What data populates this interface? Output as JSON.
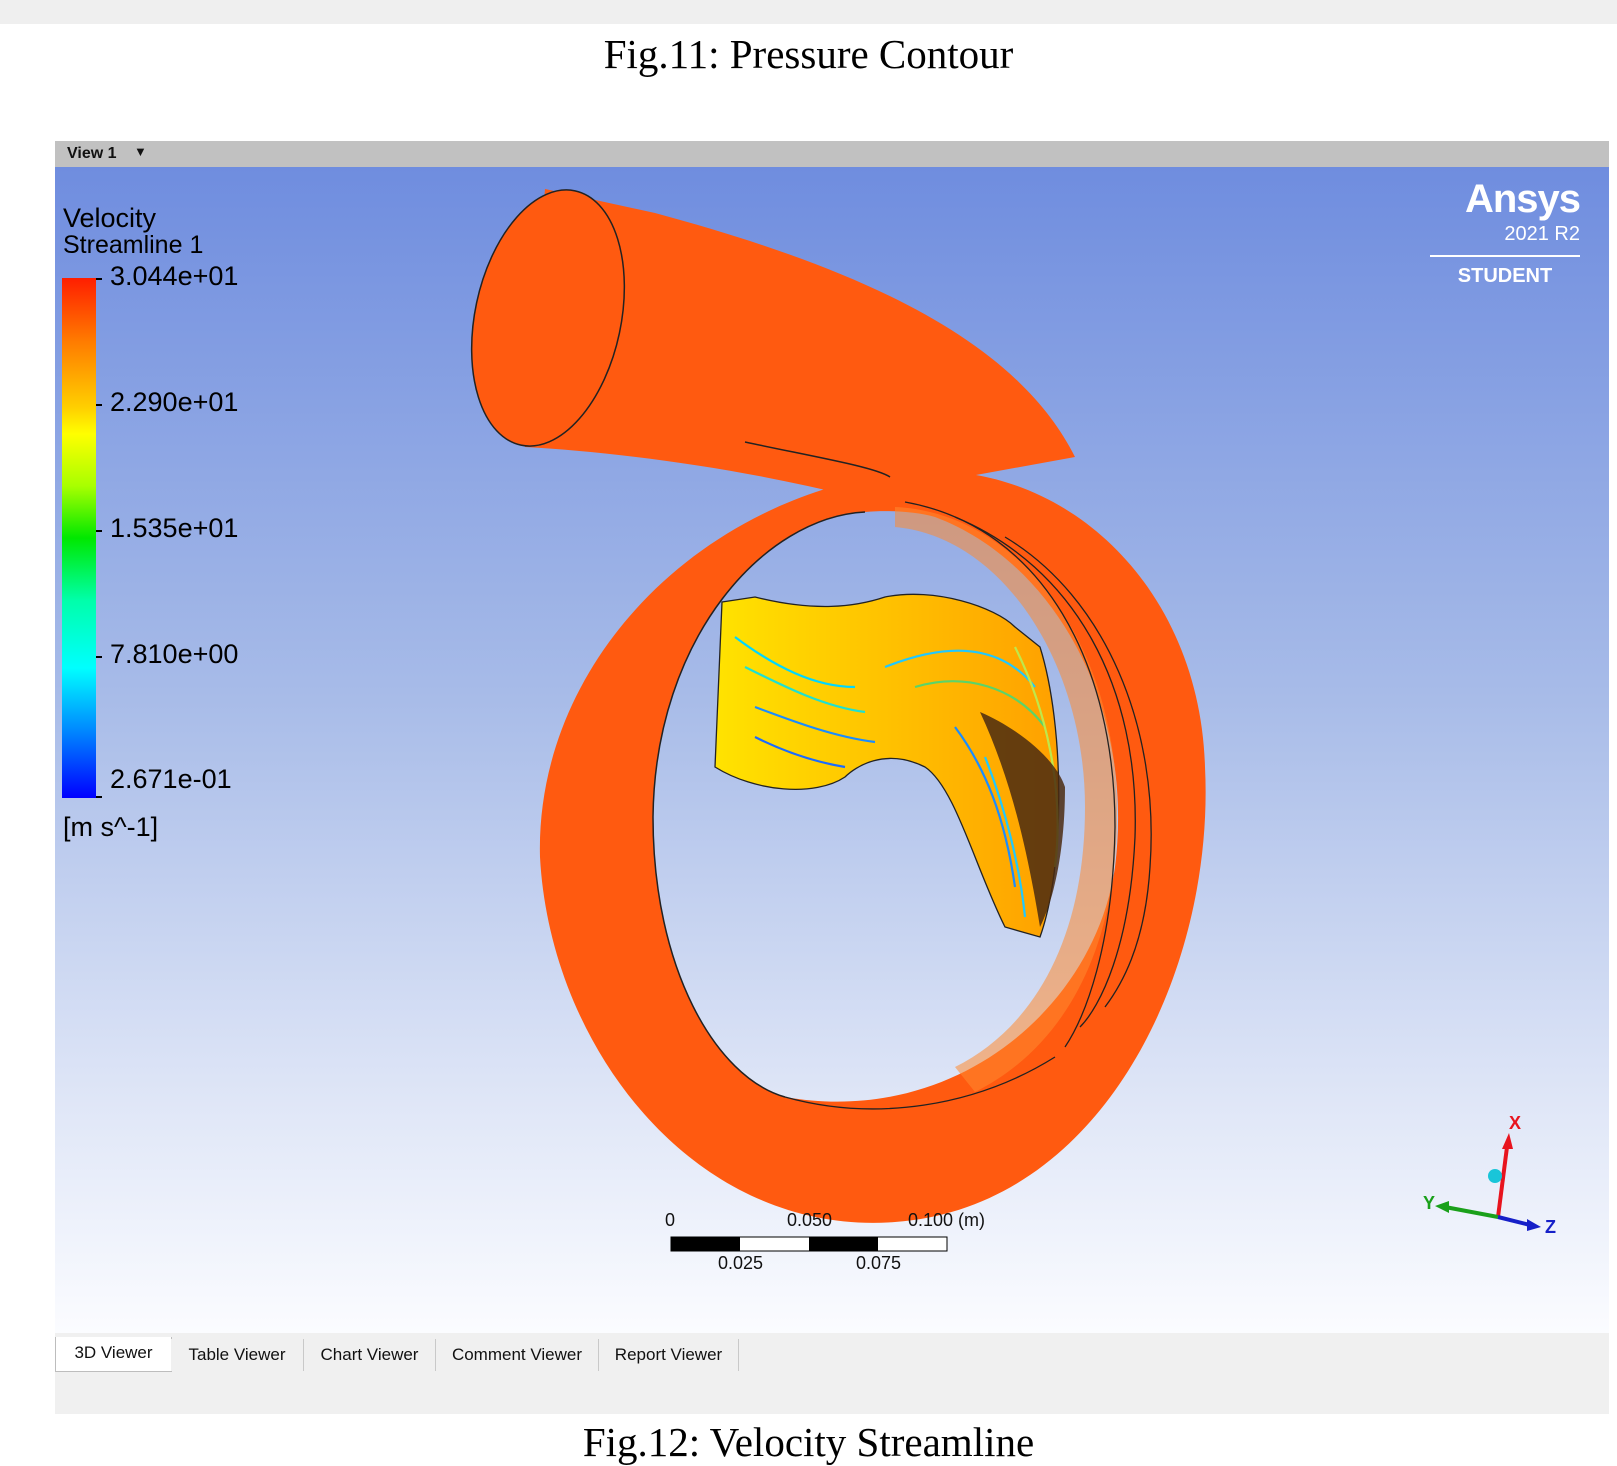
{
  "captions": {
    "top": "Fig.11: Pressure Contour",
    "bottom": "Fig.12: Velocity Streamline"
  },
  "view": {
    "title": "View 1",
    "dropdown_icon": "triangle-down-icon"
  },
  "legend": {
    "title": "Velocity",
    "subtitle": "Streamline 1",
    "ticks": [
      "3.044e+01",
      "2.290e+01",
      "1.535e+01",
      "7.810e+00",
      "2.671e-01"
    ],
    "unit": "[m s^-1]",
    "colors": [
      "#ff1e00",
      "#ffff00",
      "#00e800",
      "#00ffff",
      "#0000ff"
    ]
  },
  "branding": {
    "name": "Ansys",
    "version": "2021 R2",
    "edition": "STUDENT"
  },
  "scale_bar": {
    "top_labels": [
      "0",
      "0.050",
      "0.100"
    ],
    "unit": "(m)",
    "bottom_labels": [
      "0.025",
      "0.075"
    ]
  },
  "axes": {
    "x": "X",
    "y": "Y",
    "z": "Z",
    "colors": {
      "x": "#e8141e",
      "y": "#1aa01a",
      "z": "#1620c8"
    }
  },
  "tabs": [
    {
      "label": "3D Viewer",
      "active": true
    },
    {
      "label": "Table Viewer",
      "active": false
    },
    {
      "label": "Chart Viewer",
      "active": false
    },
    {
      "label": "Comment Viewer",
      "active": false
    },
    {
      "label": "Report Viewer",
      "active": false
    }
  ],
  "colors": {
    "volute": "#ff5a10",
    "background_top": "#6f8ddf",
    "background_bottom": "#fbfcff"
  }
}
